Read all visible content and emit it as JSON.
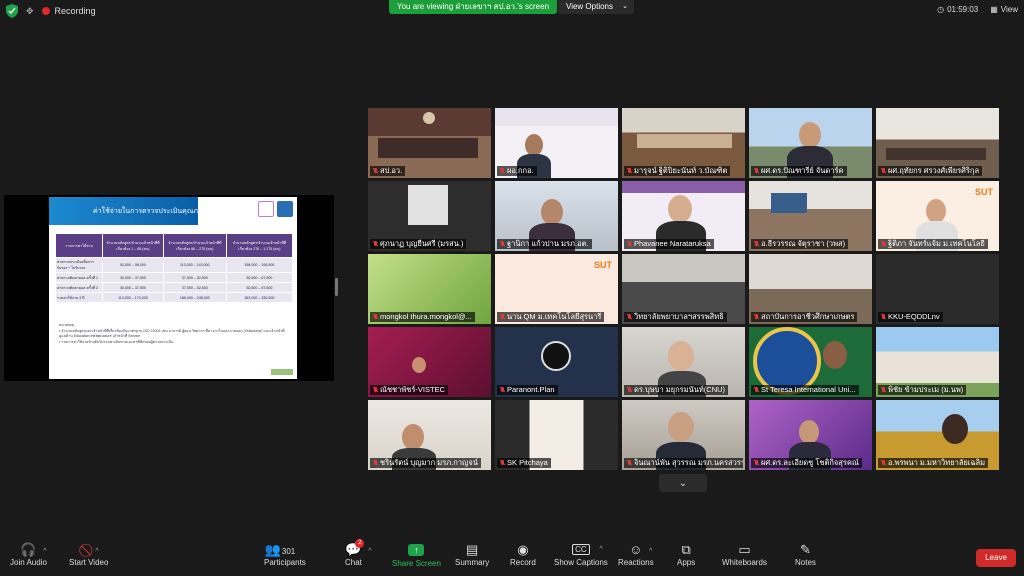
{
  "topbar": {
    "recording_label": "Recording",
    "viewing_banner": "You are viewing ฝ่ายเลขาฯ สป.อว.'s screen",
    "view_options": "View Options",
    "timer": "01:59:03",
    "view_label": "View"
  },
  "colors": {
    "accent_green": "#1fa34a",
    "recording_red": "#e02828",
    "leave_red": "#d12a2a",
    "active_speaker": "#a8d26b"
  },
  "slide": {
    "title": "ค่าใช้จ่ายในการตรวจประเมินคุณภาพ",
    "table": {
      "headers": [
        "รายการค่าใช้จ่าย",
        "จำนวนหลักสูตร/จำนวนเจ้าหน้าที่ที่เกี่ยวข้อง 1 – 65 (คน)",
        "จำนวนหลักสูตร/จำนวนเจ้าหน้าที่ที่เกี่ยวข้อง 66 – 275 (คน)",
        "จำนวนหลักสูตร/จำนวนเจ้าหน้าที่ที่เกี่ยวข้อง 276 – 1,175 (คน)"
      ],
      "rows": [
        [
          "ค่าตรวจประเมินเพื่อการรับรอง + ใบรับรอง",
          "53,000 – 98,000",
          "113,000 – 143,000",
          "158,000 – 195,500"
        ],
        [
          "ค่าตรวจติดตามผล ครั้งที่ 1",
          "30,000 – 37,500",
          "37,500 – 52,500",
          "52,500 – 67,500"
        ],
        [
          "ค่าตรวจติดตามผล ครั้งที่ 2",
          "30,000 – 37,500",
          "37,500 – 52,500",
          "52,500 – 67,500"
        ],
        [
          "รวมค่าใช้จ่าย 3 ปี",
          "113,000 – 173,000",
          "188,000 – 248,000",
          "263,000 – 330,500"
        ]
      ]
    },
    "notes_heading": "หมายเหตุ :",
    "notes": [
      "จำนวนหลักสูตรและเจ้าหน้าที่ที่เกี่ยวข้องกับมาตรฐาน ISO 21001 เช่น อาจารย์ ผู้สอน วิทยากร ที่มาจากในและภายนอก (Outsource) และเจ้าหน้าที่ดูแลด้าน Education infrastructure เจ้าหน้าที่ Service",
      "รายการค่าใช้จ่ายข้างต้นไม่รวมค่าเดินทางและค่าที่พักของผู้ตรวจประเมิน"
    ]
  },
  "participants": [
    {
      "name": "สป.อว.",
      "muted": true,
      "active": true
    },
    {
      "name": "ผอ.กกอ.",
      "muted": true
    },
    {
      "name": "มารุจน์ ฐิติปิยะนันท์ ว.บัณฑิต",
      "muted": true
    },
    {
      "name": "ผศ.ดร.ปัณฑารีย์ จันดาร์ค",
      "muted": true
    },
    {
      "name": "ผศ.ฤทัยกร ศรวงศ์เพียรศิริกุล",
      "muted": true
    },
    {
      "name": "ศุภนาฏ บุญยืนศรี (มรสน.)",
      "muted": true
    },
    {
      "name": "ฐานิกา แก้วปาน มรภ.อต.",
      "muted": true
    },
    {
      "name": "Phavanee Narataruksa",
      "muted": true
    },
    {
      "name": "อ.ธีรวรรณ จัตุราชา (วพส)",
      "muted": true
    },
    {
      "name": "ฐิติภา จันทร์แจ้ม ม.เทคโนโลยี",
      "muted": true
    },
    {
      "name": "mongkol thura.mongkol@...",
      "muted": true
    },
    {
      "name": "นาน QM ม.เทคโนโลยีสุรนารี",
      "muted": true
    },
    {
      "name": "วิทยาลัยพยาบาลฯสรรพสิทธิ",
      "muted": true
    },
    {
      "name": "สถาบันการอาชีวศึกษาเกษตร",
      "muted": true
    },
    {
      "name": "KKU-EQDDLnv",
      "muted": true
    },
    {
      "name": "ณัชชาพัชร์-VISTEC",
      "muted": true
    },
    {
      "name": "Paranont.Plan",
      "muted": true
    },
    {
      "name": "ดร.บุษบา มยุกรมนันท์(CNU)",
      "muted": true
    },
    {
      "name": "St Teresa International Uni...",
      "muted": true
    },
    {
      "name": "พิชัย ข้ามประเม (ม.นพ)",
      "muted": true
    },
    {
      "name": "ชรินรัตน์ บุญมาก มรภ.กาญจน์",
      "muted": true
    },
    {
      "name": "SK Pitchaya",
      "muted": true
    },
    {
      "name": "จินณาน์พัน สุวรรณ มรภ.นครสวรรค์",
      "muted": true
    },
    {
      "name": "ผศ.ดร.ละเอียดชู โชติกิจสุรคณ์",
      "muted": true
    },
    {
      "name": "อ.พรพนา ม.มหาวิทยาลัยเฉลิม",
      "muted": true
    }
  ],
  "bottombar": {
    "join_audio": "Join Audio",
    "start_video": "Start Video",
    "participants": "Participants",
    "participants_count": "301",
    "chat": "Chat",
    "chat_badge": "2",
    "share_screen": "Share Screen",
    "summary": "Summary",
    "record": "Record",
    "show_captions": "Show Captions",
    "reactions": "Reactions",
    "apps": "Apps",
    "whiteboards": "Whiteboards",
    "notes": "Notes",
    "leave": "Leave"
  }
}
